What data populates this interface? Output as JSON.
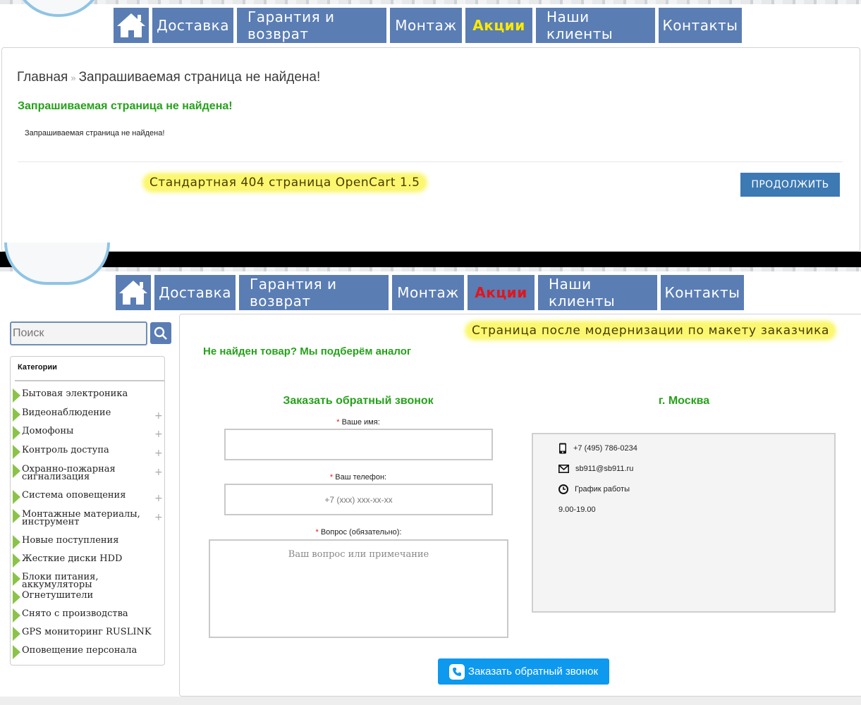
{
  "nav": {
    "items": [
      {
        "label": "Доставка"
      },
      {
        "label": "Гарантия и возврат"
      },
      {
        "label": "Монтаж"
      },
      {
        "label": "Акции"
      },
      {
        "label": "Наши клиенты"
      },
      {
        "label": "Контакты"
      }
    ],
    "home_icon": "home-icon",
    "promo_color_top": "#ffea00",
    "promo_color_bottom": "#e0161c",
    "bg_color": "#5a7db4"
  },
  "page404": {
    "breadcrumb_home": "Главная",
    "breadcrumb_sep": "»",
    "breadcrumb_current": "Запрашиваемая страница не найдена!",
    "heading": "Запрашиваемая страница не найдена!",
    "message": "Запрашиваемая страница не найдена!",
    "annotation": "Стандартная 404 страница OpenCart 1.5",
    "continue_button": "ПРОДОЛЖИТЬ"
  },
  "sidebar": {
    "search_placeholder": "Поиск",
    "search_icon": "search-icon",
    "categories_title": "Категории",
    "categories": [
      {
        "label": "Бытовая электроника",
        "expandable": false
      },
      {
        "label": "Видеонаблюдение",
        "expandable": true
      },
      {
        "label": "Домофоны",
        "expandable": true
      },
      {
        "label": "Контроль доступа",
        "expandable": true
      },
      {
        "label": "Охранно-пожарная сигнализация",
        "expandable": true
      },
      {
        "label": "Система оповещения",
        "expandable": true
      },
      {
        "label": "Монтажные материалы, инструмент",
        "expandable": true
      },
      {
        "label": "Новые поступления",
        "expandable": false
      },
      {
        "label": "Жесткие диски HDD",
        "expandable": false
      },
      {
        "label": "Блоки питания, аккумуляторы",
        "expandable": false
      },
      {
        "label": "Огнетушители",
        "expandable": false
      },
      {
        "label": "Снято с производства",
        "expandable": false
      },
      {
        "label": "GPS мониторинг RUSLINK",
        "expandable": false
      },
      {
        "label": "Оповещение персонала",
        "expandable": false
      }
    ],
    "expand_symbol": "+"
  },
  "new404": {
    "annotation": "Страница после модернизации по макету заказчика",
    "heading": "Не найден товар? Мы подберём аналог",
    "callback_title": "Заказать обратный звонок",
    "required_mark": "*",
    "name_label": "Ваше имя:",
    "phone_label": "Ваш телефон:",
    "phone_placeholder": "+7 (xxx) xxx-xx-xx",
    "question_label": "Вопрос (обязательно):",
    "question_placeholder": "Ваш вопрос или примечание",
    "submit_button": "Заказать обратный звонок",
    "city": "г. Москва",
    "phone": "+7 (495) 786-0234",
    "email": "sb911@sb911.ru",
    "schedule_label": "График работы",
    "schedule_hours": "9.00-19.00"
  }
}
